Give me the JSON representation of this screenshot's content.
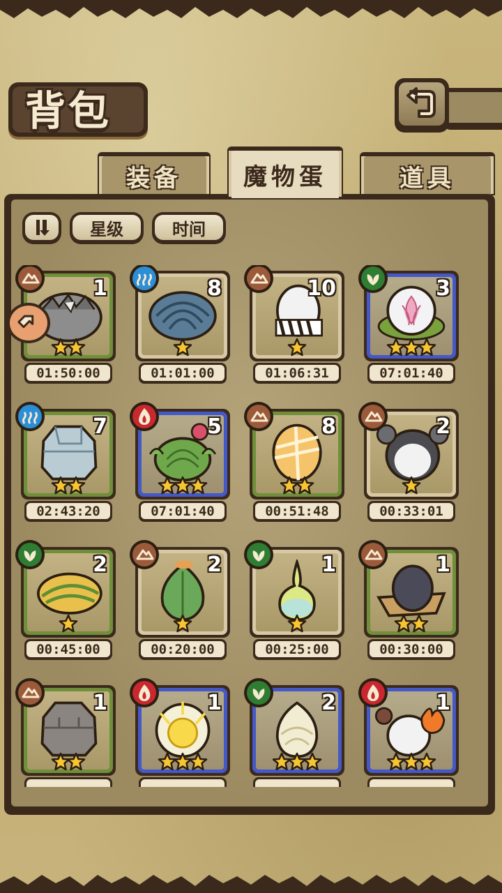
{
  "title": "背包",
  "tabs": [
    {
      "label": "装备",
      "active": false
    },
    {
      "label": "魔物蛋",
      "active": true
    },
    {
      "label": "道具",
      "active": false
    }
  ],
  "sort": {
    "order_icon": "sort-order-icon",
    "star_label": "星级",
    "time_label": "时间"
  },
  "colors": {
    "earth": "#9b5a3a",
    "water": "#2c8fd6",
    "plant": "#2e7d32",
    "fire": "#c8282e",
    "frame_green": "#6f8f3a",
    "frame_beige": "#d8c9a4",
    "frame_blue": "#4458c8"
  },
  "eggs": [
    {
      "element": "earth",
      "frame": "green",
      "count": "1",
      "stars": 2,
      "timer": "01:50:00",
      "egg": "gray-spiky"
    },
    {
      "element": "water",
      "frame": "brown",
      "count": "8",
      "stars": 1,
      "timer": "01:01:00",
      "egg": "blue-shell"
    },
    {
      "element": "earth",
      "frame": "brown",
      "count": "10",
      "stars": 1,
      "timer": "01:06:31",
      "egg": "white-zebra"
    },
    {
      "element": "plant",
      "frame": "blue",
      "count": "3",
      "stars": 3,
      "timer": "07:01:40",
      "egg": "lotus-bubble"
    },
    {
      "element": "water",
      "frame": "green",
      "count": "7",
      "stars": 2,
      "timer": "02:43:20",
      "egg": "ice-rock"
    },
    {
      "element": "fire",
      "frame": "blue",
      "count": "5",
      "stars": 3,
      "timer": "07:01:40",
      "egg": "cactus"
    },
    {
      "element": "earth",
      "frame": "green",
      "count": "8",
      "stars": 2,
      "timer": "00:51:48",
      "egg": "orange-wrapped"
    },
    {
      "element": "earth",
      "frame": "brown",
      "count": "2",
      "stars": 1,
      "timer": "00:33:01",
      "egg": "gray-koala"
    },
    {
      "element": "plant",
      "frame": "green",
      "count": "2",
      "stars": 1,
      "timer": "00:45:00",
      "egg": "leaf-yellow"
    },
    {
      "element": "earth",
      "frame": "brown",
      "count": "2",
      "stars": 1,
      "timer": "00:20:00",
      "egg": "green-sprout"
    },
    {
      "element": "plant",
      "frame": "brown",
      "count": "1",
      "stars": 1,
      "timer": "00:25:00",
      "egg": "yellow-bulb"
    },
    {
      "element": "earth",
      "frame": "green",
      "count": "1",
      "stars": 2,
      "timer": "00:30:00",
      "egg": "dark-hat"
    },
    {
      "element": "earth",
      "frame": "green",
      "count": "1",
      "stars": 2,
      "timer": "",
      "egg": "stone-rock"
    },
    {
      "element": "fire",
      "frame": "blue",
      "count": "1",
      "stars": 3,
      "timer": "",
      "egg": "lightning-sun"
    },
    {
      "element": "plant",
      "frame": "blue",
      "count": "2",
      "stars": 3,
      "timer": "",
      "egg": "white-lotus"
    },
    {
      "element": "fire",
      "frame": "blue",
      "count": "1",
      "stars": 3,
      "timer": "",
      "egg": "flame-horn"
    }
  ],
  "icons": {
    "back": "back-arrow-icon",
    "side": "side-arrow-icon",
    "star": "star-icon"
  }
}
